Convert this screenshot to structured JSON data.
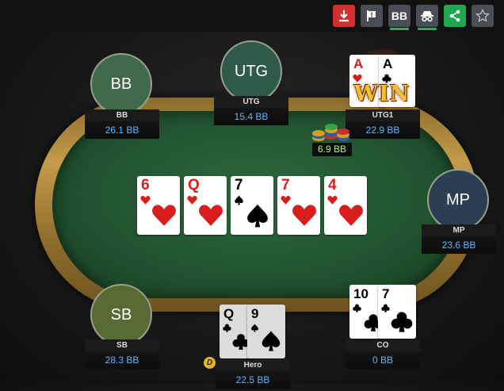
{
  "toolbar": {
    "download": "download-icon",
    "report": "flag-exclamation-icon",
    "bb_label": "BB",
    "incognito": "incognito-icon",
    "share": "share-icon",
    "favorite": "star-icon",
    "colors": {
      "download": "#d32f2f",
      "share": "#1fa84f",
      "active_underline": "#1fb35c"
    }
  },
  "players": [
    {
      "position": "BB",
      "avatar_text": "BB",
      "name": "BB",
      "stack": "26.1 BB",
      "avatar_color": "#3f6b4a"
    },
    {
      "position": "UTG",
      "avatar_text": "UTG",
      "name": "UTG",
      "stack": "15.4 BB",
      "avatar_color": "#2f5a4a"
    },
    {
      "position": "UTG1",
      "name": "UTG1",
      "stack": "22.9 BB",
      "cards": [
        {
          "rank": "A",
          "suit": "heart"
        },
        {
          "rank": "A",
          "suit": "club"
        }
      ],
      "win_label": "WIN"
    },
    {
      "position": "MP",
      "avatar_text": "MP",
      "name": "MP",
      "stack": "23.6 BB",
      "avatar_color": "#2c3e52"
    },
    {
      "position": "CO",
      "name": "CO",
      "stack": "0 BB",
      "cards": [
        {
          "rank": "10",
          "suit": "club"
        },
        {
          "rank": "7",
          "suit": "club"
        }
      ]
    },
    {
      "position": "Hero",
      "name": "Hero",
      "stack": "22.5 BB",
      "dealer_button": "D",
      "cards": [
        {
          "rank": "Q",
          "suit": "club"
        },
        {
          "rank": "9",
          "suit": "spade"
        }
      ]
    },
    {
      "position": "SB",
      "avatar_text": "SB",
      "name": "SB",
      "stack": "28.3 BB",
      "avatar_color": "#5a6a35"
    }
  ],
  "pot": "6.9 BB",
  "board": [
    {
      "rank": "6",
      "suit": "heart"
    },
    {
      "rank": "Q",
      "suit": "heart"
    },
    {
      "rank": "7",
      "suit": "spade"
    },
    {
      "rank": "7",
      "suit": "heart"
    },
    {
      "rank": "4",
      "suit": "heart"
    }
  ]
}
